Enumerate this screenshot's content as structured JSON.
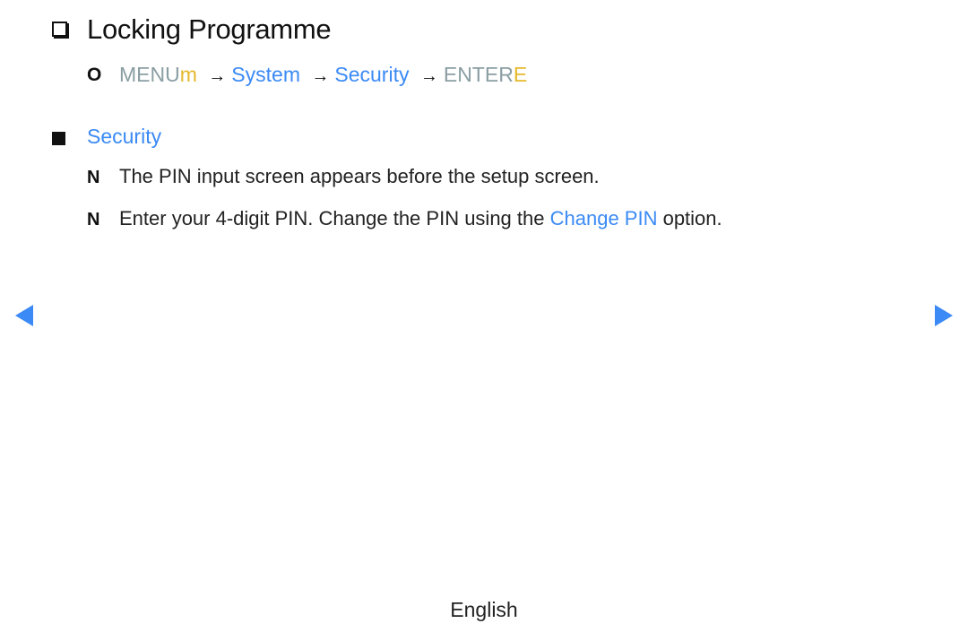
{
  "section": {
    "title": "Locking Programme",
    "title_icon": "checkbox-square-icon"
  },
  "menu_path": {
    "marker": "O",
    "menu_label": "MENU",
    "menu_key": "m",
    "arrow": "→",
    "steps": [
      "System",
      "Security"
    ],
    "enter_label": "ENTER",
    "enter_key": "E"
  },
  "subsection": {
    "bullet_icon": "filled-square-icon",
    "heading": "Security",
    "notes": [
      {
        "marker": "N",
        "text": "The PIN input screen appears before the setup screen."
      },
      {
        "marker": "N",
        "text_before": "Enter your 4-digit PIN. Change the PIN using the ",
        "link": "Change PIN",
        "text_after": " option."
      }
    ]
  },
  "navigation": {
    "prev_icon": "left-triangle-icon",
    "next_icon": "right-triangle-icon"
  },
  "footer": {
    "language": "English"
  },
  "colors": {
    "accent_blue": "#3b8af5",
    "key_gray": "#8a9ea3",
    "key_yellow": "#e5b92b",
    "text": "#111111"
  }
}
